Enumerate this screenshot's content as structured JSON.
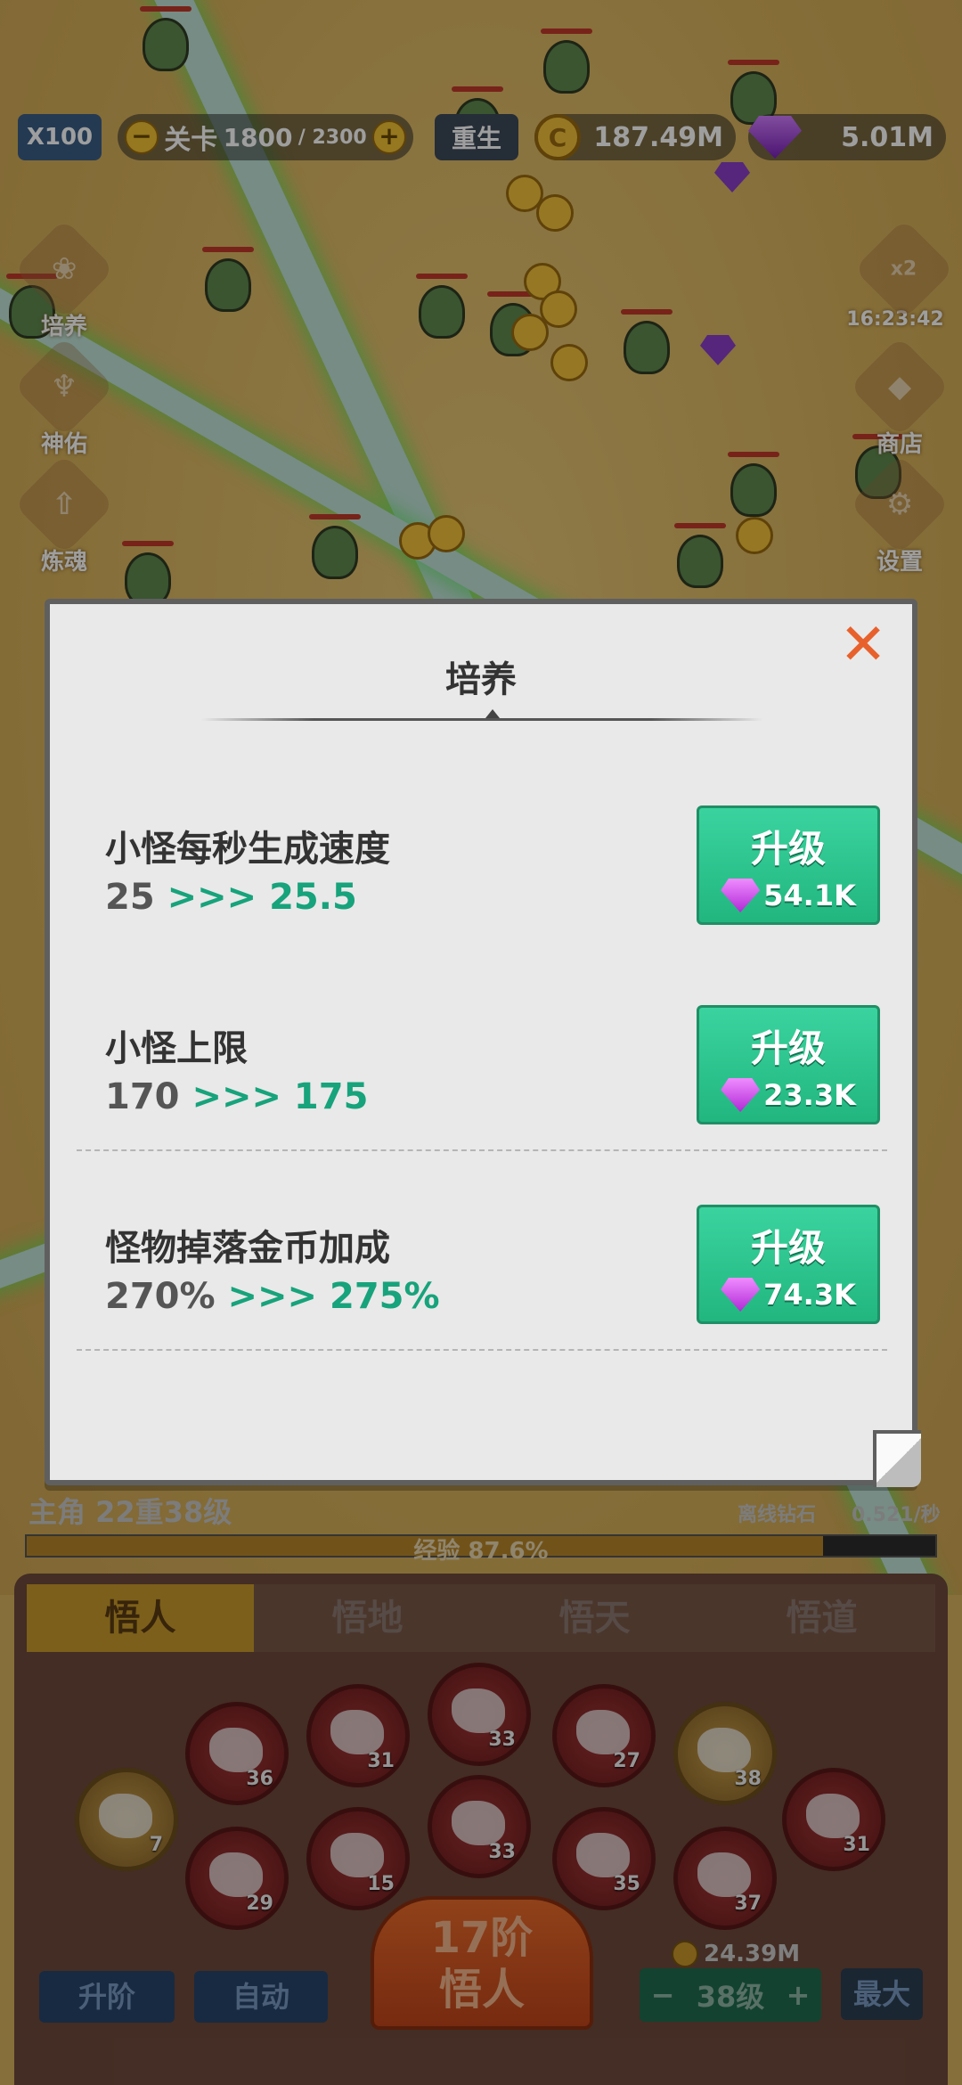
{
  "hud": {
    "speed": "X100",
    "stage_label": "关卡",
    "stage_current": "1800",
    "stage_total": "/ 2300",
    "rebirth": "重生",
    "coin_symbol": "C",
    "coins": "187.49M",
    "gems": "5.01M"
  },
  "side_left": [
    {
      "label": "培养",
      "icon": "cultivate-icon"
    },
    {
      "label": "神佑",
      "icon": "blessing-icon"
    },
    {
      "label": "炼魂",
      "icon": "soul-icon"
    }
  ],
  "side_right": {
    "boost_label": "x2",
    "boost_timer": "16:23:42",
    "shop": "商店",
    "settings": "设置"
  },
  "modal": {
    "title": "培养",
    "close_icon": "close-icon",
    "rows": [
      {
        "name": "小怪每秒生成速度",
        "old": "25",
        "arrow": ">>>",
        "new": "25.5",
        "button": "升级",
        "cost": "54.1K"
      },
      {
        "name": "小怪上限",
        "old": "170",
        "arrow": ">>>",
        "new": "175",
        "button": "升级",
        "cost": "23.3K"
      },
      {
        "name": "怪物掉落金币加成",
        "old": "270%",
        "arrow": ">>>",
        "new": "275%",
        "button": "升级",
        "cost": "74.3K"
      }
    ]
  },
  "player": {
    "label": "主角 22重38级",
    "offline_label": "离线钻石",
    "offline_rate": "0.521/秒",
    "xp_text": "经验 87.6%",
    "xp_fraction": 0.876
  },
  "panel": {
    "tabs": [
      "悟人",
      "悟地",
      "悟天",
      "悟道"
    ],
    "active_tab": 0,
    "zodiac_levels": [
      "7",
      "36",
      "29",
      "31",
      "15",
      "33",
      "33",
      "27",
      "35",
      "38",
      "37",
      "31"
    ],
    "upgrade_rank": "升阶",
    "auto": "自动",
    "rank_line1": "17阶",
    "rank_line2": "悟人",
    "level_cost": "24.39M",
    "level_minus": "−",
    "level_value": "38级",
    "level_plus": "+",
    "max": "最大"
  },
  "colors": {
    "accent_green": "#17a37b",
    "close_orange": "#e8612c",
    "button_green": "#2cc48d"
  }
}
